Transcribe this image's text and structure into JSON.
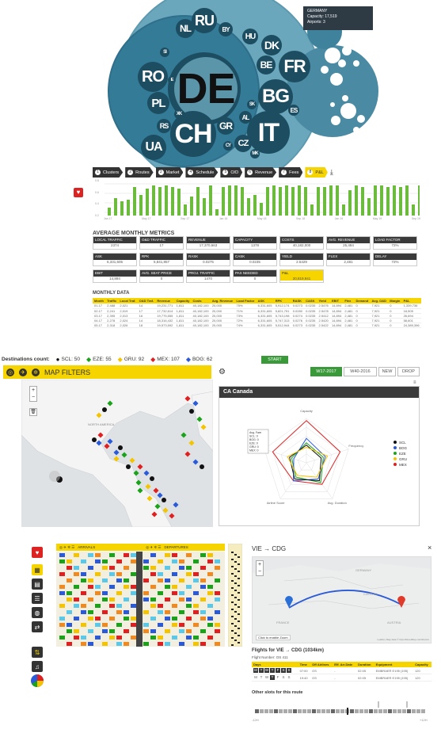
{
  "panel_bubbles": {
    "tooltip": {
      "title": "GERMANY",
      "line1": "Capacity: 17,519",
      "line2": "Airports: 3"
    },
    "countries": [
      "DE",
      "CH",
      "IT",
      "FR",
      "BG",
      "RO",
      "RU",
      "DK",
      "BE",
      "NL",
      "PL",
      "UA",
      "ES",
      "BY",
      "HU",
      "GR",
      "RS",
      "CZ",
      "AL",
      "MK",
      "SI",
      "XK",
      "SK",
      "IE",
      "CY"
    ]
  },
  "panel_metrics": {
    "steps": [
      {
        "num": "1",
        "label": "Clusters"
      },
      {
        "num": "2",
        "label": "Routes"
      },
      {
        "num": "3",
        "label": "Market"
      },
      {
        "num": "4",
        "label": "Schedule"
      },
      {
        "num": "5",
        "label": "O/D"
      },
      {
        "num": "6",
        "label": "Revenue"
      },
      {
        "num": "7",
        "label": "Fees"
      },
      {
        "num": "8",
        "label": "P&L"
      }
    ],
    "download_icon": "download-icon",
    "chart_axis": [
      "0.8",
      "0.6",
      "0.4",
      "0.2"
    ],
    "chart_months": [
      "Jan 17",
      "May 17",
      "Sep 17",
      "Jan 18",
      "May 18",
      "Sep 18",
      "Jan 19",
      "May 19",
      "Sep 19"
    ],
    "section_title": "AVERAGE MONTHLY METRICS",
    "metrics": [
      {
        "label": "LOCAL TRAFFIC",
        "value": "2374"
      },
      {
        "label": "O&D TRAFFIC",
        "value": "17"
      },
      {
        "label": "REVENUE",
        "value": "17,370,663"
      },
      {
        "label": "CAPACITY",
        "value": "1378"
      },
      {
        "label": "COSTS",
        "value": "40,182,000"
      },
      {
        "label": "AVG. REVENUE",
        "value": "25,484"
      },
      {
        "label": "LOAD FACTOR",
        "value": "72%"
      },
      {
        "label": "ASK",
        "value": "6,331,605"
      },
      {
        "label": "RPK",
        "value": "5,841,857"
      },
      {
        "label": "RASK",
        "value": "0.0275"
      },
      {
        "label": "CASK",
        "value": "0.0235"
      },
      {
        "label": "YIELD",
        "value": "2.5429"
      },
      {
        "label": "FLEX",
        "value": "2,481"
      },
      {
        "label": "DELAY",
        "value": "72%"
      },
      {
        "label": "EBIT",
        "value": "14,894"
      },
      {
        "label": "AVG. SEAT PRICE",
        "value": "0"
      },
      {
        "label": "PROJ. TRAFFIC",
        "value": "1470"
      },
      {
        "label": "PAX NEEDED",
        "value": "0"
      },
      {
        "label": "P&L",
        "value": "20,819,941"
      }
    ],
    "monthly_title": "MONTHLY DATA",
    "monthly_headers": [
      "Month",
      "Traffic",
      "Local Traf.",
      "O&D Traf.",
      "Revenue",
      "Capacity",
      "Costs",
      "Avg. Revenue",
      "Load Factor",
      "ASK",
      "RPK",
      "RASK",
      "CASK",
      "Yield",
      "EBIT",
      "Flex",
      "Demand",
      "Avg. O&D",
      "Margin",
      "P&L"
    ],
    "monthly_rows": [
      [
        "01.17",
        "2,488",
        "2,021",
        "14",
        "19,231,771",
        "1,811",
        "40,182,100",
        "20,000",
        "75%",
        "6,331,605",
        "5,912,174",
        "0.0273",
        "0.0235",
        "2.5476",
        "14,894",
        "2,481",
        "0",
        "7,921",
        "0",
        "1,339,736"
      ],
      [
        "02.17",
        "2,241",
        "2,019",
        "17",
        "17,732,614",
        "1,811",
        "40,182,100",
        "20,000",
        "71%",
        "6,331,605",
        "5,821,751",
        "0.0280",
        "0.0235",
        "2.5478",
        "14,894",
        "2,481",
        "0",
        "7,921",
        "0",
        "18,505"
      ],
      [
        "03.17",
        "2,395",
        "2,013",
        "16",
        "19,775,555",
        "1,811",
        "40,182,100",
        "20,000",
        "73%",
        "6,331,605",
        "5,743,198",
        "0.0274",
        "0.0235",
        "2.5412",
        "14,894",
        "2,481",
        "0",
        "7,921",
        "0",
        "26,694"
      ],
      [
        "04.17",
        "2,278",
        "2,024",
        "14",
        "18,316,432",
        "1,811",
        "40,182,100",
        "20,000",
        "72%",
        "6,331,605",
        "5,747,313",
        "0.0276",
        "0.0235",
        "2.5420",
        "14,894",
        "2,481",
        "0",
        "7,921",
        "0",
        "58,601"
      ],
      [
        "05.17",
        "2,318",
        "2,026",
        "18",
        "19,573,592",
        "1,811",
        "40,182,100",
        "20,000",
        "74%",
        "6,331,605",
        "5,512,944",
        "0.0273",
        "0.0235",
        "2.5422",
        "14,894",
        "2,481",
        "0",
        "7,921",
        "0",
        "24,389,396"
      ]
    ]
  },
  "panel_map": {
    "legend_title": "Destinations count:",
    "legend": [
      {
        "code": "SCL",
        "count": "50",
        "color": "#111111",
        "shape": "●"
      },
      {
        "code": "EZE",
        "count": "55",
        "color": "#1aa31a",
        "shape": "◆"
      },
      {
        "code": "GRU",
        "count": "92",
        "color": "#f5c400",
        "shape": "◆"
      },
      {
        "code": "MEX",
        "count": "107",
        "color": "#e02020",
        "shape": "◆"
      },
      {
        "code": "BOG",
        "count": "62",
        "color": "#2a5ad8",
        "shape": "◆"
      }
    ],
    "start_label": "START",
    "filters_title": "MAP FILTERS",
    "tabs": [
      "W17-2017",
      "W40-2016",
      "NEW",
      "DROP"
    ],
    "map_label": "NORTH AMERICA",
    "radar_title": "CA Canada",
    "radar_axes": [
      "Capacity",
      "Frequency",
      "Avg. Duration",
      "Airline Score",
      "Avg. Fare"
    ],
    "radar_legend": [
      "SCL",
      "BOG",
      "EZE",
      "GRU",
      "MEX"
    ],
    "radar_tooltip": [
      "Avg. Fare",
      "SCL: 0",
      "BOG: 0",
      "EZE: 0",
      "GRU: 0",
      "MEX: 0"
    ]
  },
  "panel_route": {
    "route_title": "VIE → CDG",
    "close": "×",
    "grid_labels": [
      "ARRIVALS",
      "DEPARTURES"
    ],
    "map_countries": [
      "GERMANY",
      "FRANCE",
      "CZECHIA",
      "AUSTRIA"
    ],
    "zoom_in": "+",
    "zoom_out": "−",
    "map_toggle": "Click to enable Zoom",
    "map_credit": "Leaflet | Map data © OpenStreetMap contributors",
    "flights_title": "Flights for VIE → CDG (1034km)",
    "flight_number_label": "Flight Number:",
    "flight_number_value": "OS 411",
    "flight_headers": [
      "Days",
      "Time",
      "Off Airlines",
      "Eff. Arr.Date",
      "Duration",
      "Equipment",
      "Capacity"
    ],
    "flights": [
      {
        "days": [
          "M",
          "T",
          "W",
          "T",
          "F",
          "S",
          "S"
        ],
        "on": [
          1,
          1,
          1,
          1,
          1,
          1,
          1
        ],
        "time": "07:00",
        "off": "OS",
        "eff": "-",
        "duration": "02:05",
        "equip": "EMBRAER E195 (195)",
        "cap": "120"
      },
      {
        "days": [
          "M",
          "T",
          "W",
          "T",
          "F",
          "S",
          "S"
        ],
        "on": [
          0,
          0,
          0,
          1,
          0,
          0,
          0
        ],
        "time": "19:40",
        "off": "OS",
        "eff": "-",
        "duration": "02:05",
        "equip": "EMBRAER E195 (195)",
        "cap": "120"
      }
    ],
    "other_title": "Other slots for this route",
    "slider_min": "-12H",
    "slider_max": "+12H"
  }
}
